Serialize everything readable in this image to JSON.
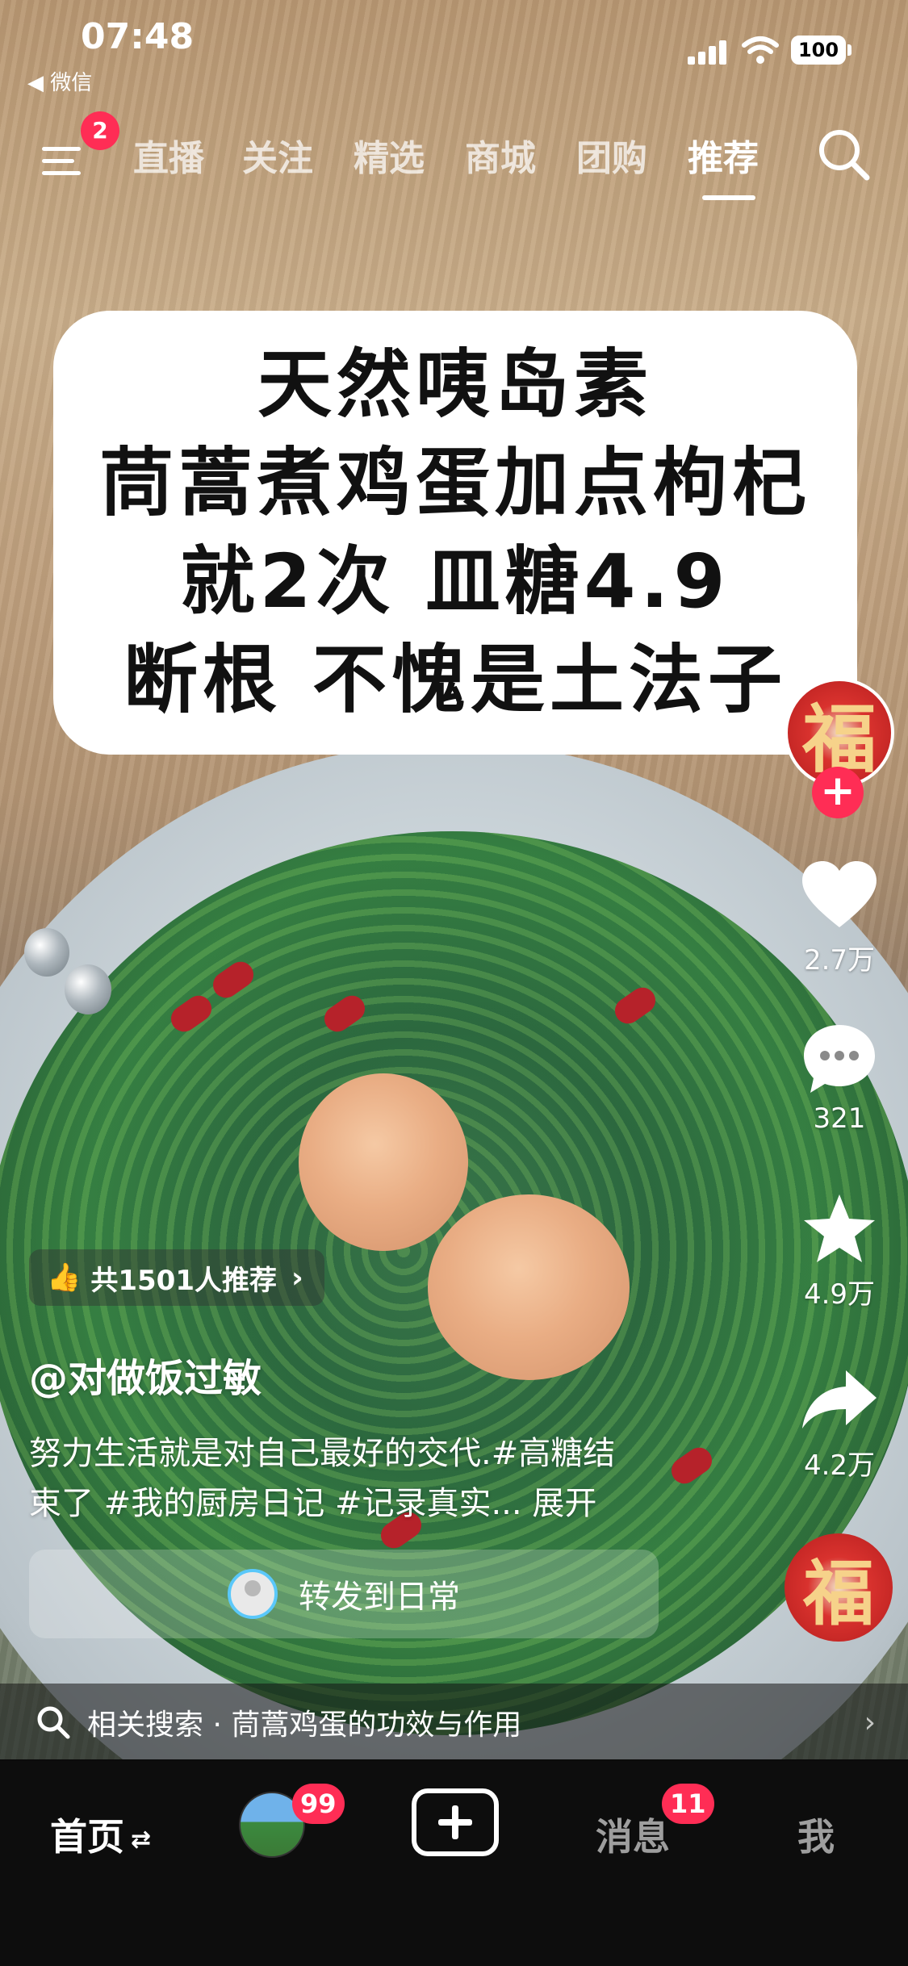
{
  "status_bar": {
    "time": "07:48",
    "back_app": "◀ 微信",
    "battery": "100"
  },
  "top_nav": {
    "menu_badge": "2",
    "tabs": [
      {
        "label": "直播",
        "active": false
      },
      {
        "label": "关注",
        "active": false
      },
      {
        "label": "精选",
        "active": false
      },
      {
        "label": "商城",
        "active": false
      },
      {
        "label": "团购",
        "active": false
      },
      {
        "label": "推荐",
        "active": true
      }
    ]
  },
  "video": {
    "title_lines": [
      "天然咦岛素",
      "茼蒿煮鸡蛋加点枸杞",
      "就2次 皿糖4.9",
      "断根 不愧是土法子"
    ]
  },
  "right_rail": {
    "author_avatar_glyph": "福",
    "like_count": "2.7万",
    "comment_count": "321",
    "favorite_count": "4.9万",
    "share_count": "4.2万",
    "music_disc_glyph": "福"
  },
  "recommend_pill": {
    "text": "共1501人推荐"
  },
  "author": "@对做饭过敏",
  "caption": {
    "line1": "努力生活就是对自己最好的交代.#高糖结",
    "line2": "束了 #我的厨房日记 #记录真实... 展开"
  },
  "share_daily": {
    "label": "转发到日常"
  },
  "related_search": {
    "text": "相关搜索 · 茼蒿鸡蛋的功效与作用"
  },
  "bottom_bar": {
    "home": "首页",
    "friends_badge": "99",
    "messages": "消息",
    "messages_badge": "11",
    "me": "我"
  },
  "colors": {
    "accent_red": "#ff2d55",
    "bottom_bar_bg": "#0d0d0d"
  }
}
